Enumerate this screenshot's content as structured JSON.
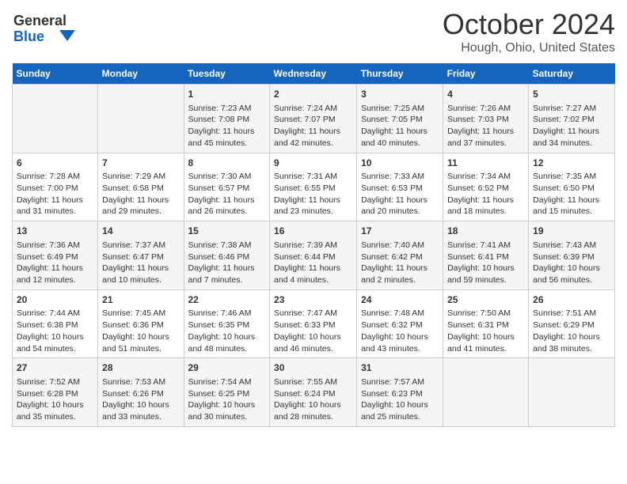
{
  "header": {
    "logo_line1": "General",
    "logo_line2": "Blue",
    "title": "October 2024",
    "subtitle": "Hough, Ohio, United States"
  },
  "days_of_week": [
    "Sunday",
    "Monday",
    "Tuesday",
    "Wednesday",
    "Thursday",
    "Friday",
    "Saturday"
  ],
  "weeks": [
    [
      {
        "day": "",
        "content": ""
      },
      {
        "day": "",
        "content": ""
      },
      {
        "day": "1",
        "content": "Sunrise: 7:23 AM\nSunset: 7:08 PM\nDaylight: 11 hours and 45 minutes."
      },
      {
        "day": "2",
        "content": "Sunrise: 7:24 AM\nSunset: 7:07 PM\nDaylight: 11 hours and 42 minutes."
      },
      {
        "day": "3",
        "content": "Sunrise: 7:25 AM\nSunset: 7:05 PM\nDaylight: 11 hours and 40 minutes."
      },
      {
        "day": "4",
        "content": "Sunrise: 7:26 AM\nSunset: 7:03 PM\nDaylight: 11 hours and 37 minutes."
      },
      {
        "day": "5",
        "content": "Sunrise: 7:27 AM\nSunset: 7:02 PM\nDaylight: 11 hours and 34 minutes."
      }
    ],
    [
      {
        "day": "6",
        "content": "Sunrise: 7:28 AM\nSunset: 7:00 PM\nDaylight: 11 hours and 31 minutes."
      },
      {
        "day": "7",
        "content": "Sunrise: 7:29 AM\nSunset: 6:58 PM\nDaylight: 11 hours and 29 minutes."
      },
      {
        "day": "8",
        "content": "Sunrise: 7:30 AM\nSunset: 6:57 PM\nDaylight: 11 hours and 26 minutes."
      },
      {
        "day": "9",
        "content": "Sunrise: 7:31 AM\nSunset: 6:55 PM\nDaylight: 11 hours and 23 minutes."
      },
      {
        "day": "10",
        "content": "Sunrise: 7:33 AM\nSunset: 6:53 PM\nDaylight: 11 hours and 20 minutes."
      },
      {
        "day": "11",
        "content": "Sunrise: 7:34 AM\nSunset: 6:52 PM\nDaylight: 11 hours and 18 minutes."
      },
      {
        "day": "12",
        "content": "Sunrise: 7:35 AM\nSunset: 6:50 PM\nDaylight: 11 hours and 15 minutes."
      }
    ],
    [
      {
        "day": "13",
        "content": "Sunrise: 7:36 AM\nSunset: 6:49 PM\nDaylight: 11 hours and 12 minutes."
      },
      {
        "day": "14",
        "content": "Sunrise: 7:37 AM\nSunset: 6:47 PM\nDaylight: 11 hours and 10 minutes."
      },
      {
        "day": "15",
        "content": "Sunrise: 7:38 AM\nSunset: 6:46 PM\nDaylight: 11 hours and 7 minutes."
      },
      {
        "day": "16",
        "content": "Sunrise: 7:39 AM\nSunset: 6:44 PM\nDaylight: 11 hours and 4 minutes."
      },
      {
        "day": "17",
        "content": "Sunrise: 7:40 AM\nSunset: 6:42 PM\nDaylight: 11 hours and 2 minutes."
      },
      {
        "day": "18",
        "content": "Sunrise: 7:41 AM\nSunset: 6:41 PM\nDaylight: 10 hours and 59 minutes."
      },
      {
        "day": "19",
        "content": "Sunrise: 7:43 AM\nSunset: 6:39 PM\nDaylight: 10 hours and 56 minutes."
      }
    ],
    [
      {
        "day": "20",
        "content": "Sunrise: 7:44 AM\nSunset: 6:38 PM\nDaylight: 10 hours and 54 minutes."
      },
      {
        "day": "21",
        "content": "Sunrise: 7:45 AM\nSunset: 6:36 PM\nDaylight: 10 hours and 51 minutes."
      },
      {
        "day": "22",
        "content": "Sunrise: 7:46 AM\nSunset: 6:35 PM\nDaylight: 10 hours and 48 minutes."
      },
      {
        "day": "23",
        "content": "Sunrise: 7:47 AM\nSunset: 6:33 PM\nDaylight: 10 hours and 46 minutes."
      },
      {
        "day": "24",
        "content": "Sunrise: 7:48 AM\nSunset: 6:32 PM\nDaylight: 10 hours and 43 minutes."
      },
      {
        "day": "25",
        "content": "Sunrise: 7:50 AM\nSunset: 6:31 PM\nDaylight: 10 hours and 41 minutes."
      },
      {
        "day": "26",
        "content": "Sunrise: 7:51 AM\nSunset: 6:29 PM\nDaylight: 10 hours and 38 minutes."
      }
    ],
    [
      {
        "day": "27",
        "content": "Sunrise: 7:52 AM\nSunset: 6:28 PM\nDaylight: 10 hours and 35 minutes."
      },
      {
        "day": "28",
        "content": "Sunrise: 7:53 AM\nSunset: 6:26 PM\nDaylight: 10 hours and 33 minutes."
      },
      {
        "day": "29",
        "content": "Sunrise: 7:54 AM\nSunset: 6:25 PM\nDaylight: 10 hours and 30 minutes."
      },
      {
        "day": "30",
        "content": "Sunrise: 7:55 AM\nSunset: 6:24 PM\nDaylight: 10 hours and 28 minutes."
      },
      {
        "day": "31",
        "content": "Sunrise: 7:57 AM\nSunset: 6:23 PM\nDaylight: 10 hours and 25 minutes."
      },
      {
        "day": "",
        "content": ""
      },
      {
        "day": "",
        "content": ""
      }
    ]
  ]
}
